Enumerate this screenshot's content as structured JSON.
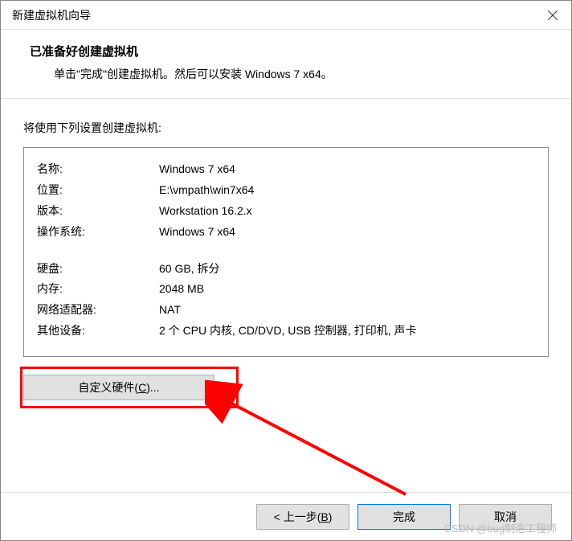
{
  "dialog": {
    "title": "新建虚拟机向导"
  },
  "header": {
    "title": "已准备好创建虚拟机",
    "subtitle": "单击\"完成\"创建虚拟机。然后可以安装 Windows 7 x64。"
  },
  "content": {
    "label": "将使用下列设置创建虚拟机:"
  },
  "summary": {
    "rows1": [
      {
        "label": "名称:",
        "value": "Windows 7 x64"
      },
      {
        "label": "位置:",
        "value": "E:\\vmpath\\win7x64"
      },
      {
        "label": "版本:",
        "value": "Workstation 16.2.x"
      },
      {
        "label": "操作系统:",
        "value": "Windows 7 x64"
      }
    ],
    "rows2": [
      {
        "label": "硬盘:",
        "value": "60 GB, 拆分"
      },
      {
        "label": "内存:",
        "value": "2048 MB"
      },
      {
        "label": "网络适配器:",
        "value": "NAT"
      },
      {
        "label": "其他设备:",
        "value": "2 个 CPU 内核, CD/DVD, USB 控制器, 打印机, 声卡"
      }
    ]
  },
  "buttons": {
    "customize_pre": "自定义硬件(",
    "customize_u": "C",
    "customize_post": ")...",
    "back_pre": "< 上一步(",
    "back_u": "B",
    "back_post": ")",
    "finish": "完成",
    "cancel": "取消"
  },
  "watermark": "CSDN @bug制造工程师"
}
